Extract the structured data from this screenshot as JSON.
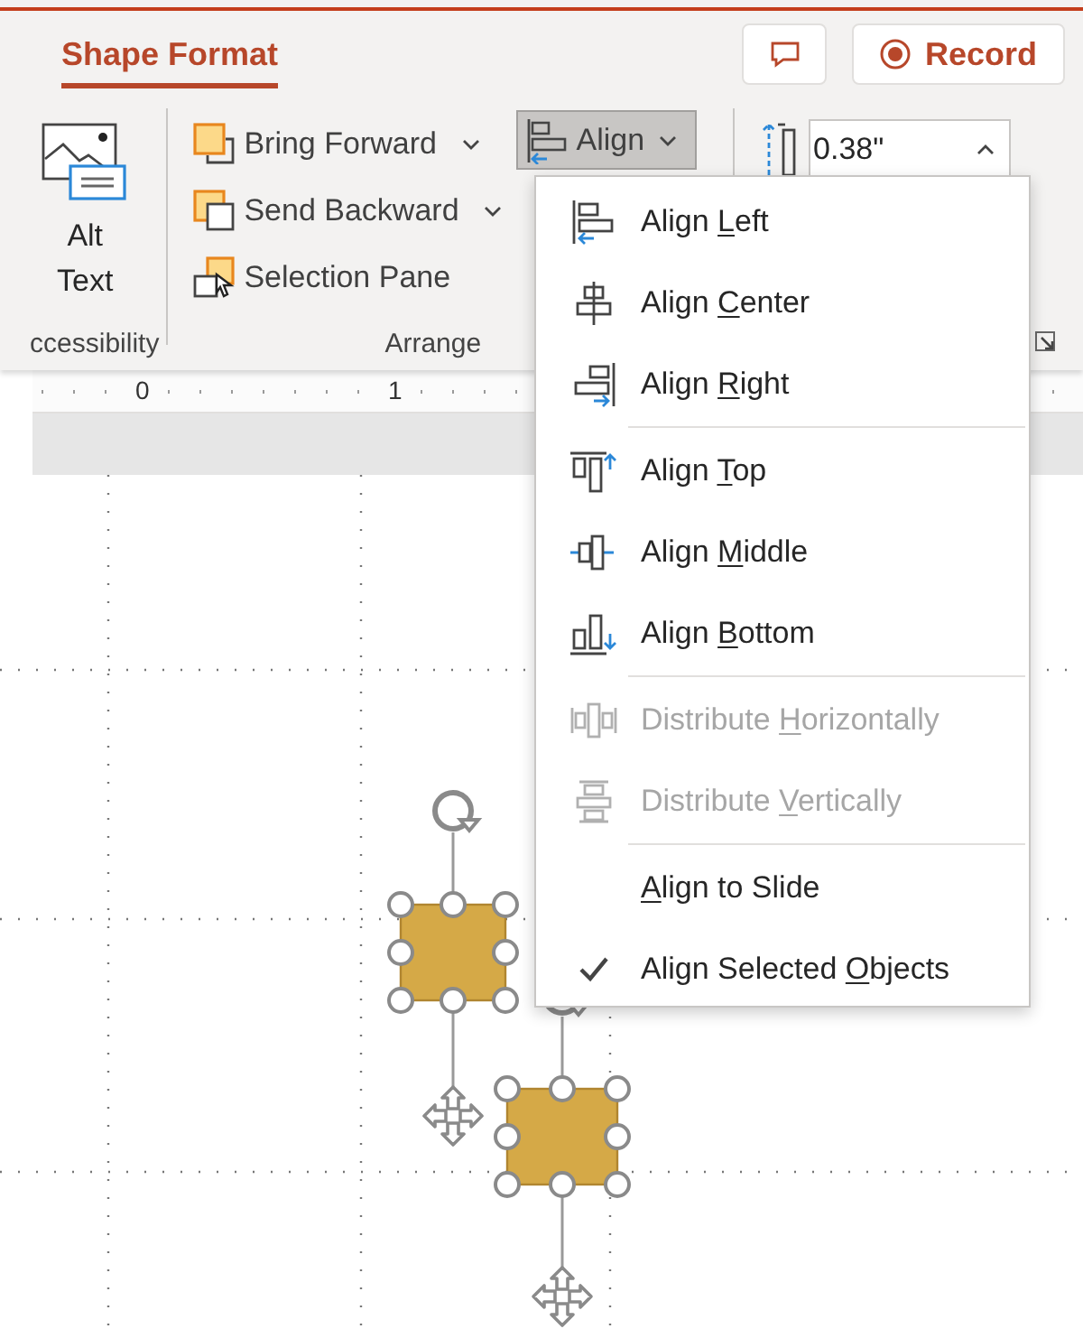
{
  "ribbon": {
    "tab": {
      "label": "Shape Format",
      "selected": true
    },
    "record_button": {
      "label": "Record"
    },
    "accessibility_group": {
      "label": "ccessibility",
      "alt_text_button": {
        "label": "Alt Text"
      }
    },
    "arrange_group": {
      "label": "Arrange",
      "buttons": [
        {
          "kind": "bring-forward",
          "label": "Bring Forward",
          "dropdown": true
        },
        {
          "kind": "send-backward",
          "label": "Send Backward",
          "dropdown": true
        },
        {
          "kind": "selection-pane",
          "label": "Selection Pane",
          "dropdown": false
        }
      ],
      "align_button": {
        "label": "Align",
        "expanded": true
      }
    },
    "size_group": {
      "height_field": {
        "value": "0.38\""
      }
    }
  },
  "ruler": {
    "marks": [
      "0",
      "1"
    ]
  },
  "align_menu": {
    "groups": [
      [
        {
          "kind": "align-left",
          "label": {
            "before": "Align ",
            "key": "L",
            "after": "eft"
          },
          "disabled": false
        },
        {
          "kind": "align-center",
          "label": {
            "before": "Align ",
            "key": "C",
            "after": "enter"
          },
          "disabled": false
        },
        {
          "kind": "align-right",
          "label": {
            "before": "Align ",
            "key": "R",
            "after": "ight"
          },
          "disabled": false
        }
      ],
      [
        {
          "kind": "align-top",
          "label": {
            "before": "Align ",
            "key": "T",
            "after": "op"
          },
          "disabled": false
        },
        {
          "kind": "align-middle",
          "label": {
            "before": "Align ",
            "key": "M",
            "after": "iddle"
          },
          "disabled": false
        },
        {
          "kind": "align-bottom",
          "label": {
            "before": "Align ",
            "key": "B",
            "after": "ottom"
          },
          "disabled": false
        }
      ],
      [
        {
          "kind": "distribute-horizontal",
          "label": {
            "before": "Distribute ",
            "key": "H",
            "after": "orizontally"
          },
          "disabled": true
        },
        {
          "kind": "distribute-vertical",
          "label": {
            "before": "Distribute ",
            "key": "V",
            "after": "ertically"
          },
          "disabled": true
        }
      ],
      [
        {
          "kind": "option",
          "label": {
            "key": "A",
            "after": "lign to Slide"
          },
          "disabled": false,
          "checked": false
        },
        {
          "kind": "option",
          "label": {
            "before": "Align Selected ",
            "key": "O",
            "after": "bjects"
          },
          "disabled": false,
          "checked": true
        }
      ]
    ]
  },
  "slide": {
    "shapes": [
      {
        "selected": true
      },
      {
        "selected": true
      }
    ]
  }
}
